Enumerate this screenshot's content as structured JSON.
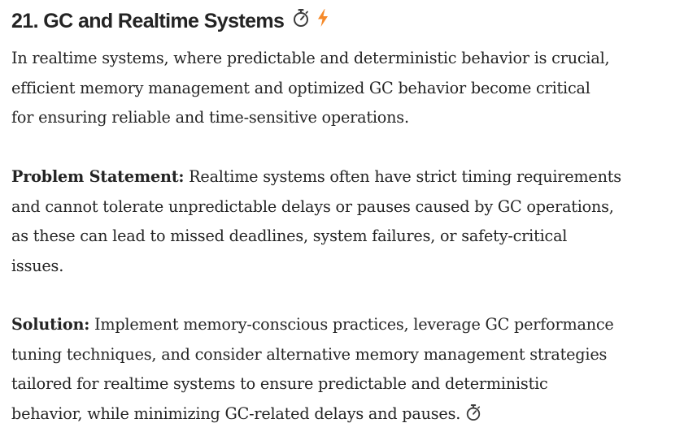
{
  "section": {
    "title": "21. GC and Realtime Systems",
    "title_icons": [
      "stopwatch-icon",
      "lightning-icon"
    ],
    "intro_lines": [
      "In realtime systems, where predictable and deterministic behavior is crucial,",
      "efficient memory management and optimized GC behavior become critical",
      "for ensuring reliable and time-sensitive operations."
    ],
    "problem": {
      "lead": "Problem Statement:",
      "lines": [
        " Realtime systems often have strict timing requirements",
        "and cannot tolerate unpredictable delays or pauses caused by GC operations,",
        "as these can lead to missed deadlines, system failures, or safety-critical",
        "issues."
      ]
    },
    "solution": {
      "lead": "Solution:",
      "lines": [
        " Implement memory-conscious practices, leverage GC performance",
        "tuning techniques, and consider alternative memory management strategies",
        "tailored for realtime systems to ensure predictable and deterministic",
        "behavior, while minimizing GC-related delays and pauses."
      ],
      "trailing_icon": "stopwatch-icon"
    }
  },
  "colors": {
    "text": "#242424",
    "lightning": "#f58a2a",
    "stopwatch": "#3c3c3c"
  }
}
